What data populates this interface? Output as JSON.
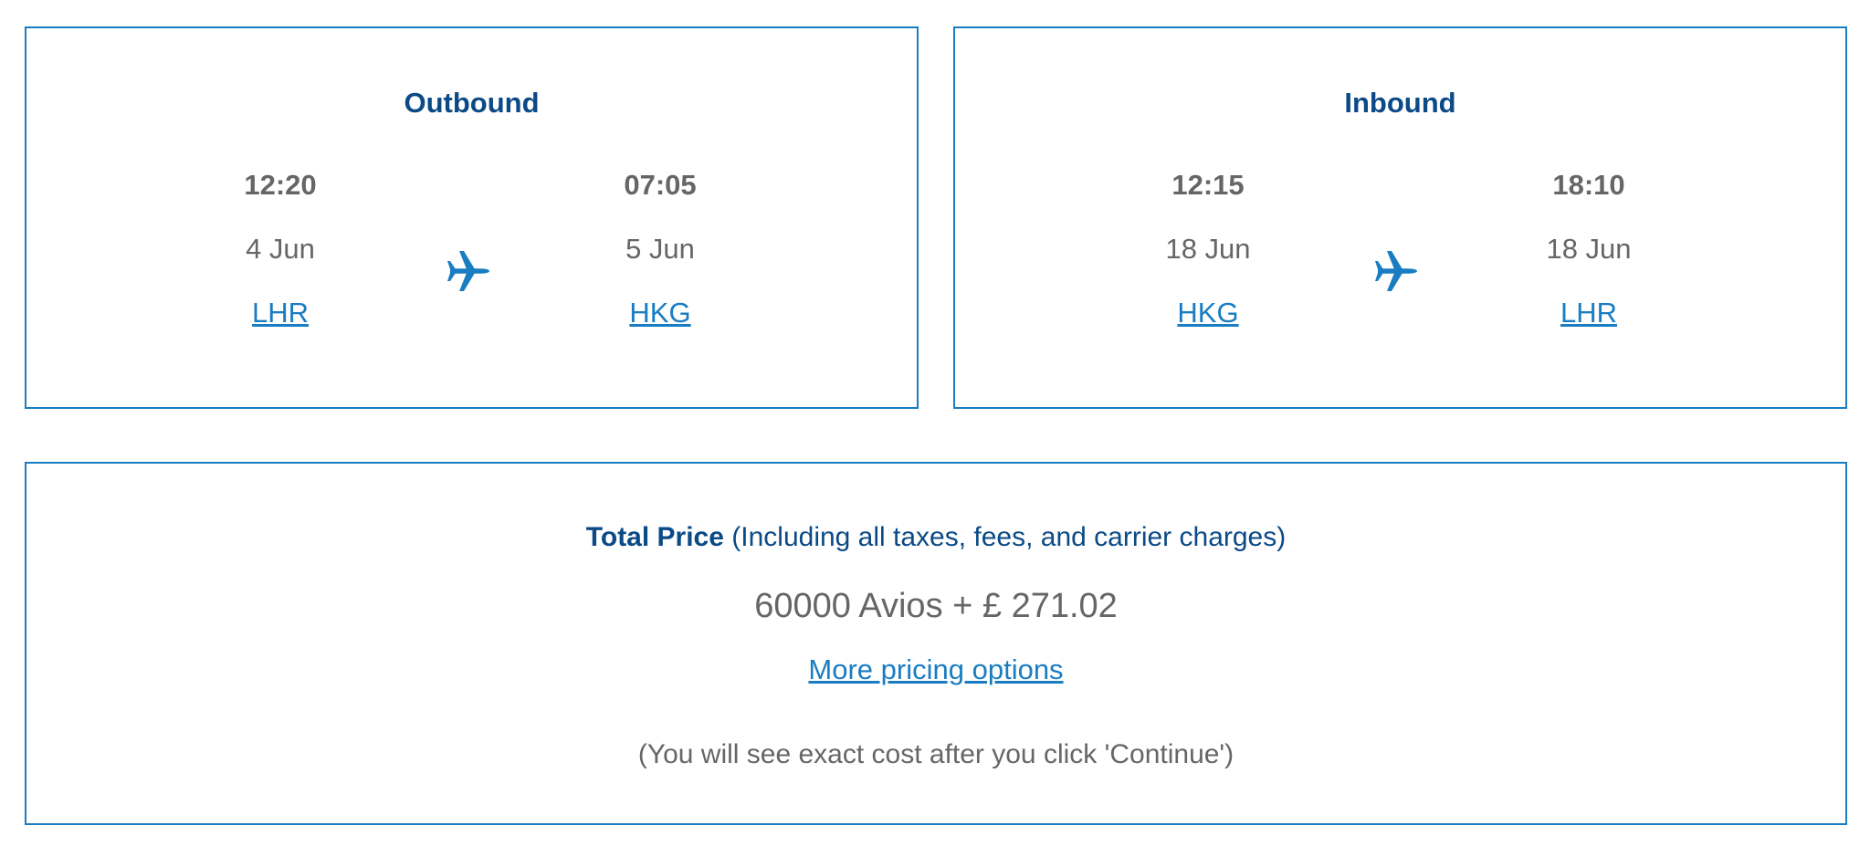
{
  "colors": {
    "accent": "#1a7dc2",
    "heading": "#0b4a86",
    "text": "#666666"
  },
  "outbound": {
    "title": "Outbound",
    "icon": "airplane-icon",
    "depart": {
      "time": "12:20",
      "date": "4 Jun",
      "airport": "LHR"
    },
    "arrive": {
      "time": "07:05",
      "date": "5 Jun",
      "airport": "HKG"
    }
  },
  "inbound": {
    "title": "Inbound",
    "icon": "airplane-icon",
    "depart": {
      "time": "12:15",
      "date": "18 Jun",
      "airport": "HKG"
    },
    "arrive": {
      "time": "18:10",
      "date": "18 Jun",
      "airport": "LHR"
    }
  },
  "price": {
    "heading_bold": "Total Price",
    "heading_note": " (Including all taxes, fees, and carrier charges)",
    "amount": "60000 Avios + £ 271.02",
    "more_options_label": "More pricing options",
    "note": "(You will see exact cost after you click 'Continue')"
  }
}
